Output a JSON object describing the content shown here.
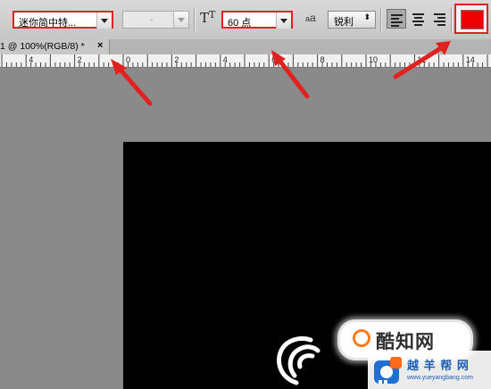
{
  "options_bar": {
    "font_family": "迷你简中特...",
    "font_style": "-",
    "font_size": "60 点",
    "antialias": "锐利",
    "antialias_arrows": "⬍",
    "aa_icon_big": "a",
    "aa_icon_small": "a",
    "text_size_icon": "T",
    "text_color": "#ef0000",
    "align_left": "left-align-icon",
    "align_center": "center-align-icon",
    "align_right": "right-align-icon"
  },
  "document_tab": {
    "title": "1 @ 100%(RGB/8) *",
    "close": "×"
  },
  "ruler": {
    "labels": [
      "4",
      "2",
      "0",
      "2",
      "4",
      "6",
      "8",
      "10",
      "12",
      "14"
    ]
  },
  "watermark": {
    "pill_text": "酷知网",
    "site_name": "越 羊 帮 网",
    "site_url": "www.yueyangbang.com"
  },
  "annotation_color": "#e0211f"
}
